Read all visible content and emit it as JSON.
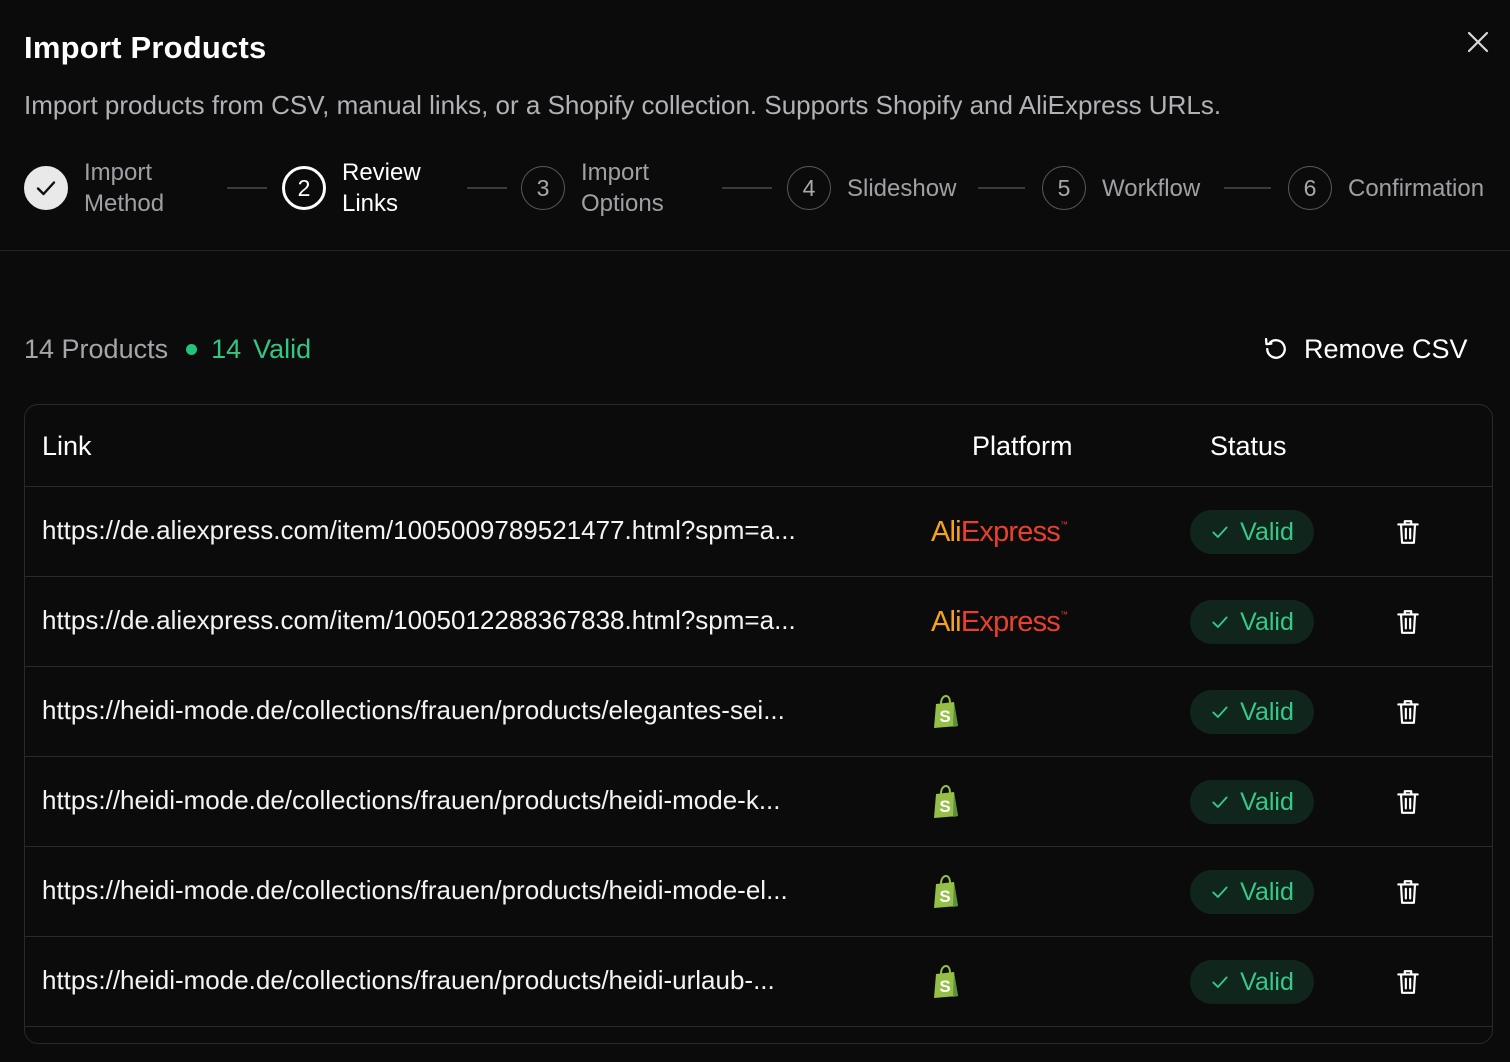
{
  "dialog": {
    "title": "Import Products",
    "subtitle": "Import products from CSV, manual links, or a Shopify collection. Supports Shopify and AliExpress URLs.",
    "close_icon": "close-icon"
  },
  "stepper": {
    "steps": [
      {
        "number": "1",
        "label": "Import\nMethod",
        "state": "done"
      },
      {
        "number": "2",
        "label": "Review\nLinks",
        "state": "active"
      },
      {
        "number": "3",
        "label": "Import\nOptions",
        "state": "upcoming"
      },
      {
        "number": "4",
        "label": "Slideshow",
        "state": "upcoming"
      },
      {
        "number": "5",
        "label": "Workflow",
        "state": "upcoming"
      },
      {
        "number": "6",
        "label": "Confirmation",
        "state": "upcoming"
      }
    ]
  },
  "summary": {
    "products_count": "14 Products",
    "valid_count": "14",
    "valid_label": "Valid",
    "remove_csv_label": "Remove CSV"
  },
  "table": {
    "columns": {
      "link": "Link",
      "platform": "Platform",
      "status": "Status"
    },
    "rows": [
      {
        "link": "https://de.aliexpress.com/item/1005009789521477.html?spm=a...",
        "platform": "AliExpress",
        "status": "Valid"
      },
      {
        "link": "https://de.aliexpress.com/item/1005012288367838.html?spm=a...",
        "platform": "AliExpress",
        "status": "Valid"
      },
      {
        "link": "https://heidi-mode.de/collections/frauen/products/elegantes-sei...",
        "platform": "Shopify",
        "status": "Valid"
      },
      {
        "link": "https://heidi-mode.de/collections/frauen/products/heidi-mode-k...",
        "platform": "Shopify",
        "status": "Valid"
      },
      {
        "link": "https://heidi-mode.de/collections/frauen/products/heidi-mode-el...",
        "platform": "Shopify",
        "status": "Valid"
      },
      {
        "link": "https://heidi-mode.de/collections/frauen/products/heidi-urlaub-...",
        "platform": "Shopify",
        "status": "Valid"
      }
    ]
  },
  "colors": {
    "background": "#0b0b0c",
    "valid_green": "#37c987",
    "badge_bg": "#10261c",
    "aliexpress_orange": "#f4a21b",
    "aliexpress_red": "#e8402c",
    "shopify_green": "#95bf47"
  }
}
